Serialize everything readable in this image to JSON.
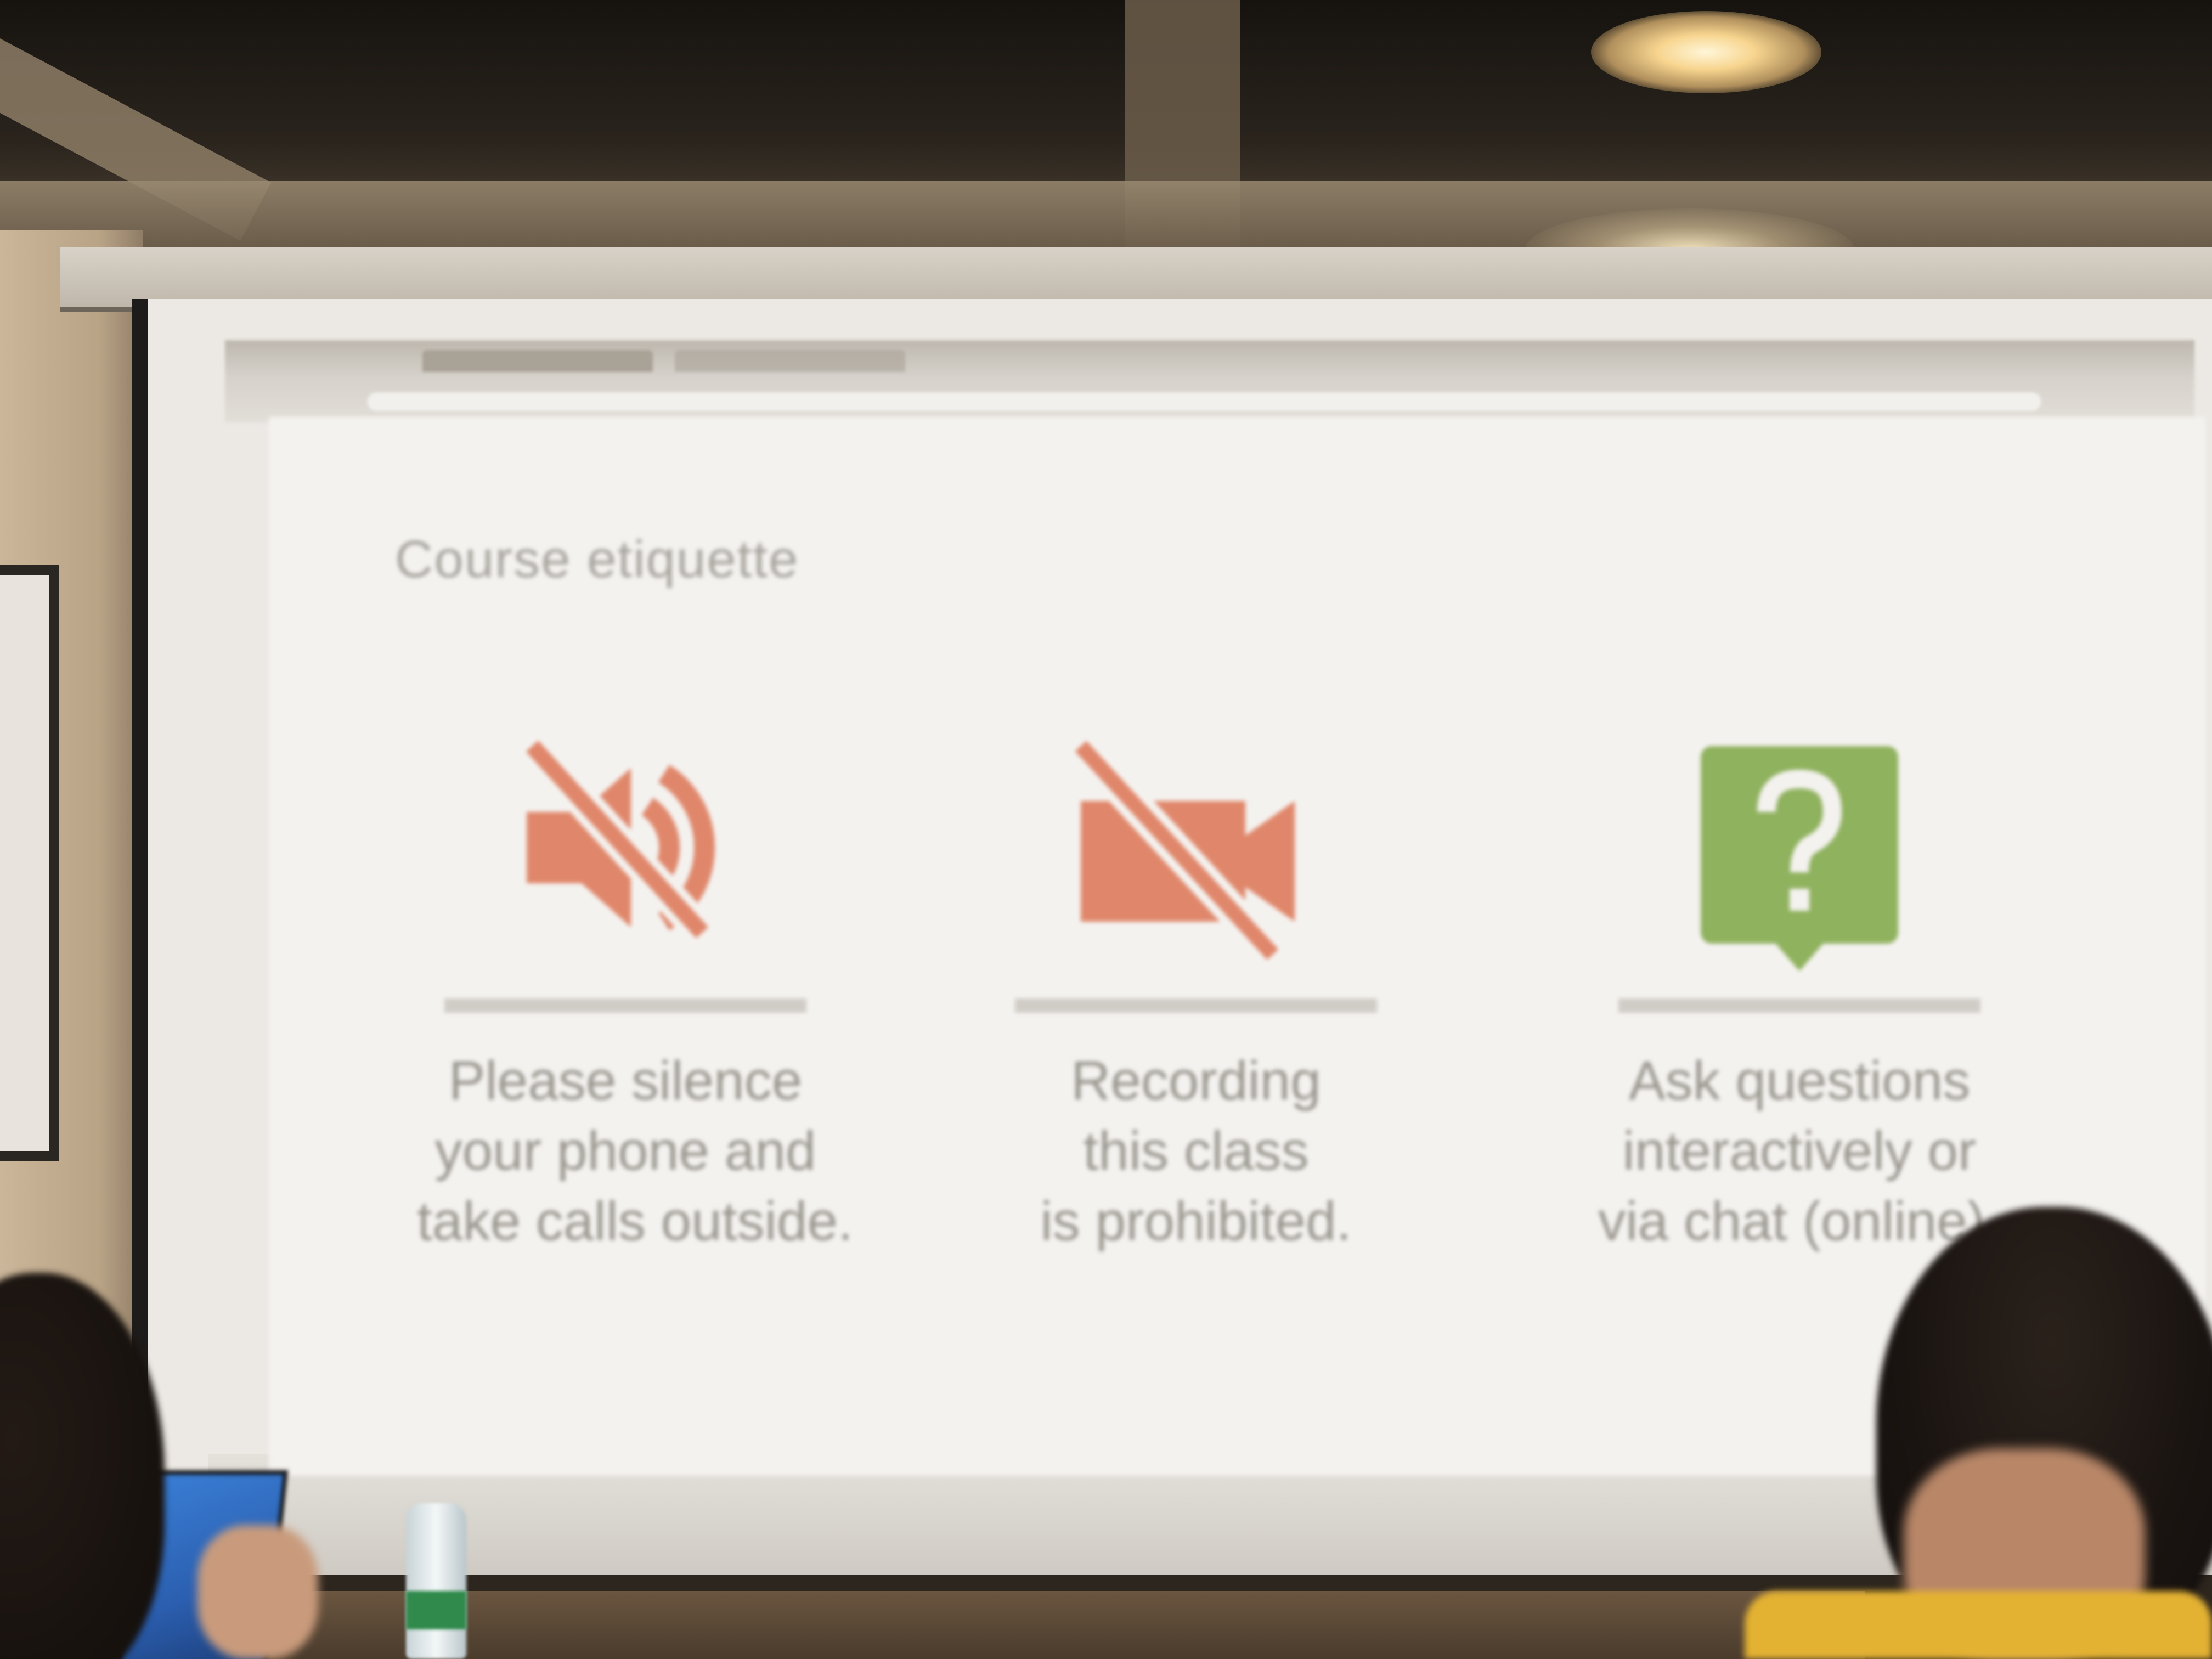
{
  "slide": {
    "title": "Course etiquette",
    "items": [
      {
        "icon": "speaker-muted-icon",
        "color": "#e0876b",
        "lines": [
          "Please silence",
          "your phone and",
          "take calls outside."
        ]
      },
      {
        "icon": "video-camera-off-icon",
        "color": "#e0876b",
        "lines": [
          "Recording",
          "this class",
          "is prohibited."
        ]
      },
      {
        "icon": "question-bubble-icon",
        "color": "#8fb25e",
        "lines": [
          "Ask questions",
          "interactively or",
          "via chat (online)."
        ]
      }
    ]
  }
}
